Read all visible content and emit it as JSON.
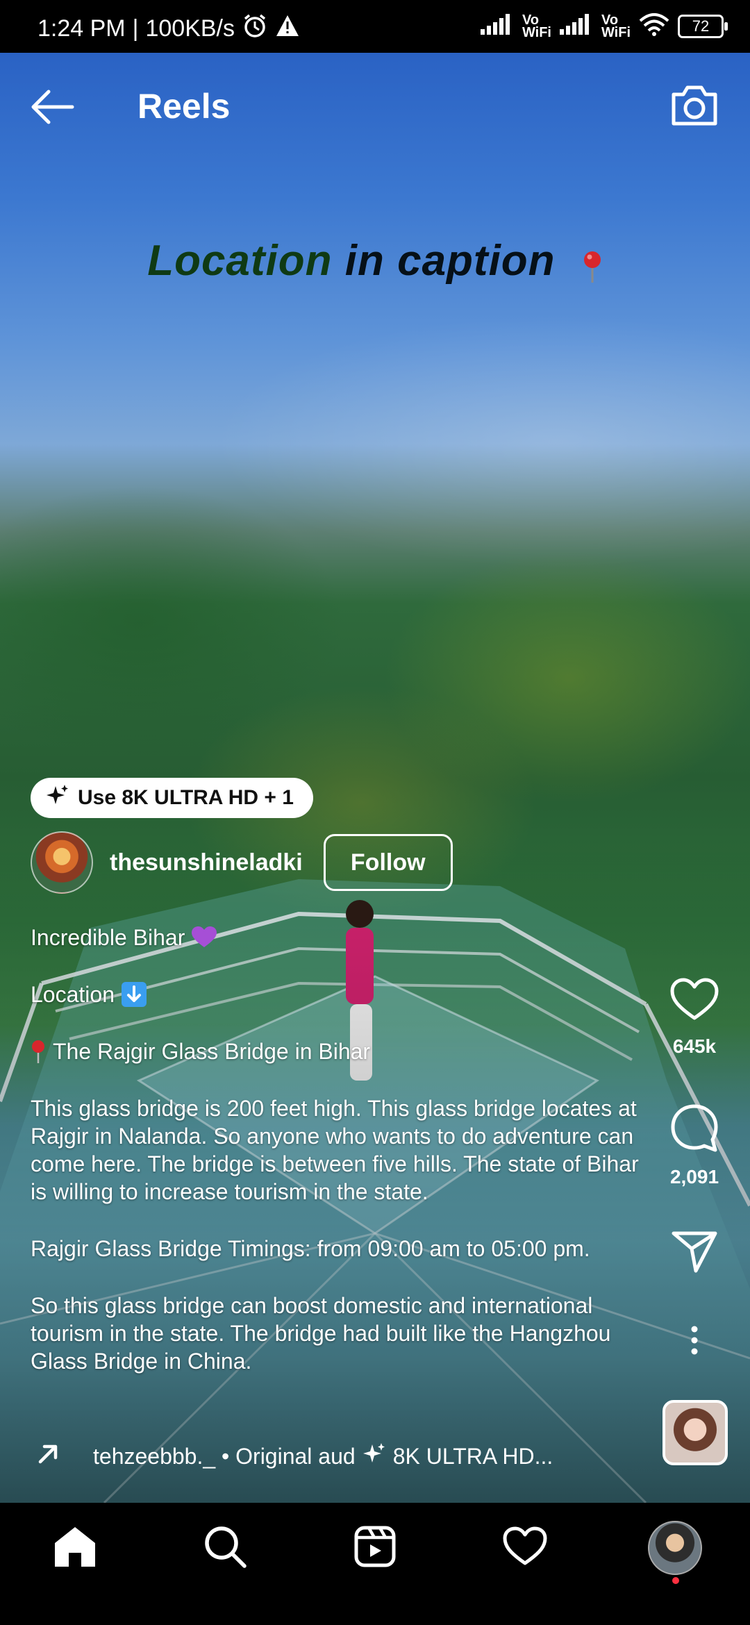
{
  "status_bar": {
    "time": "1:24 PM",
    "speed": "100KB/s",
    "battery": "72",
    "vowifi_top": "Vo",
    "vowifi_bottom": "WiFi"
  },
  "header": {
    "title": "Reels"
  },
  "video_overlay": {
    "word1": "Location",
    "word2": "in caption"
  },
  "effect_pill": {
    "label": "Use 8K ULTRA HD + 1"
  },
  "author": {
    "username": "thesunshineladki",
    "follow_label": "Follow"
  },
  "caption": {
    "line1": "Incredible Bihar",
    "line2": "Location",
    "line3": "The Rajgir Glass Bridge in Bihar",
    "paragraph1": "This glass bridge is 200 feet high. This glass bridge locates at Rajgir in Nalanda. So anyone who wants to do adventure can come here. The bridge is between five hills. The state of Bihar is willing to increase tourism in the state.",
    "paragraph2": "Rajgir Glass Bridge Timings: from 09:00 am to 05:00 pm.",
    "paragraph3": "So this glass bridge can boost domestic and international tourism in the state. The bridge had built like the Hangzhou Glass Bridge in China."
  },
  "actions": {
    "likes": "645k",
    "comments": "2,091"
  },
  "audio": {
    "text": "tehzeebbb._ • Original aud",
    "effect": "8K ULTRA HD..."
  },
  "colors": {
    "heart_emoji": "#a64fd6",
    "notification_dot": "#ff3040",
    "arrow_emoji": "#3a9ef0"
  }
}
